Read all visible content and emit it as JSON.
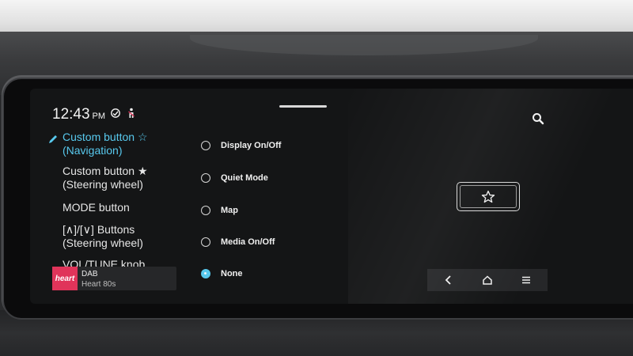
{
  "status_bar": {
    "time": "12:43",
    "ampm": "PM",
    "icons": [
      "connected-services-icon",
      "seatbelt-person-icon"
    ]
  },
  "menu": {
    "items": [
      {
        "label_line1": "Custom button ☆",
        "label_line2": "(Navigation)",
        "active": true
      },
      {
        "label_line1": "Custom button ★",
        "label_line2": "(Steering wheel)",
        "active": false
      },
      {
        "label_line1": "MODE button",
        "label_line2": "",
        "active": false
      },
      {
        "label_line1": "[∧]/[∨] Buttons",
        "label_line2": "(Steering wheel)",
        "active": false
      },
      {
        "label_line1": "VOL/TUNE knob",
        "label_line2": "",
        "active": false
      }
    ]
  },
  "media": {
    "logo_text": "heart",
    "source": "DAB",
    "station": "Heart 80s",
    "logo_color": "#e0345a"
  },
  "options": [
    {
      "label": "Display On/Off",
      "selected": false
    },
    {
      "label": "Quiet Mode",
      "selected": false
    },
    {
      "label": "Map",
      "selected": false
    },
    {
      "label": "Media On/Off",
      "selected": false
    },
    {
      "label": "None",
      "selected": true
    }
  ],
  "nav_bar": {
    "icons": [
      "back-icon",
      "home-icon",
      "menu-icon"
    ]
  },
  "colors": {
    "accent": "#58c9ee",
    "screen_bg": "#141516",
    "text": "#f0f0f0"
  }
}
